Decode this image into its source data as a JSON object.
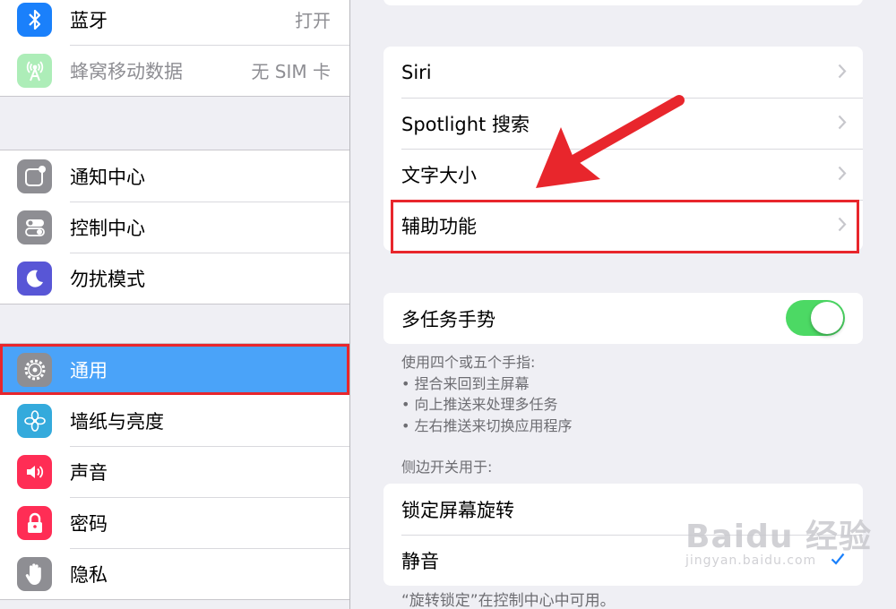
{
  "sidebar": {
    "group1": [
      {
        "label": "蓝牙",
        "value": "打开",
        "icon": "bluetooth-icon",
        "color": "#1a80fb"
      },
      {
        "label": "蜂窝移动数据",
        "value": "无 SIM 卡",
        "icon": "cellular-icon",
        "color": "#4cd964"
      }
    ],
    "group2": [
      {
        "label": "通知中心",
        "icon": "notification-center-icon",
        "color": "#8e8e93"
      },
      {
        "label": "控制中心",
        "icon": "control-center-icon",
        "color": "#8e8e93"
      },
      {
        "label": "勿扰模式",
        "icon": "moon-icon",
        "color": "#5856d6"
      }
    ],
    "group3": [
      {
        "label": "通用",
        "icon": "gear-icon",
        "color": "#8e8e93",
        "selected": true
      },
      {
        "label": "墙纸与亮度",
        "icon": "wallpaper-icon",
        "color": "#34aadc"
      },
      {
        "label": "声音",
        "icon": "speaker-icon",
        "color": "#ff2d55"
      },
      {
        "label": "密码",
        "icon": "lock-icon",
        "color": "#ff2d55"
      },
      {
        "label": "隐私",
        "icon": "hand-icon",
        "color": "#8e8e93"
      }
    ]
  },
  "detail": {
    "group1": [
      "Siri",
      "Spotlight 搜索",
      "文字大小",
      "辅助功能"
    ],
    "multitask": {
      "label": "多任务手势",
      "on": true
    },
    "multitask_note": [
      "使用四个或五个手指:",
      "• 捏合来回到主屏幕",
      "• 向上推送来处理多任务",
      "• 左右推送来切换应用程序"
    ],
    "side_switch_header": "侧边开关用于:",
    "side_switch": [
      {
        "label": "锁定屏幕旋转"
      },
      {
        "label": "静音",
        "checked": true
      }
    ],
    "footer_note": "“旋转锁定”在控制中心中可用。"
  },
  "watermark": {
    "main": "Baidu 经验",
    "sub": "jingyan.baidu.com"
  },
  "colors": {
    "selection": "#4aa3f9",
    "highlight": "#e8262c",
    "toggle_on": "#4cd964",
    "background": "#efeff4"
  }
}
